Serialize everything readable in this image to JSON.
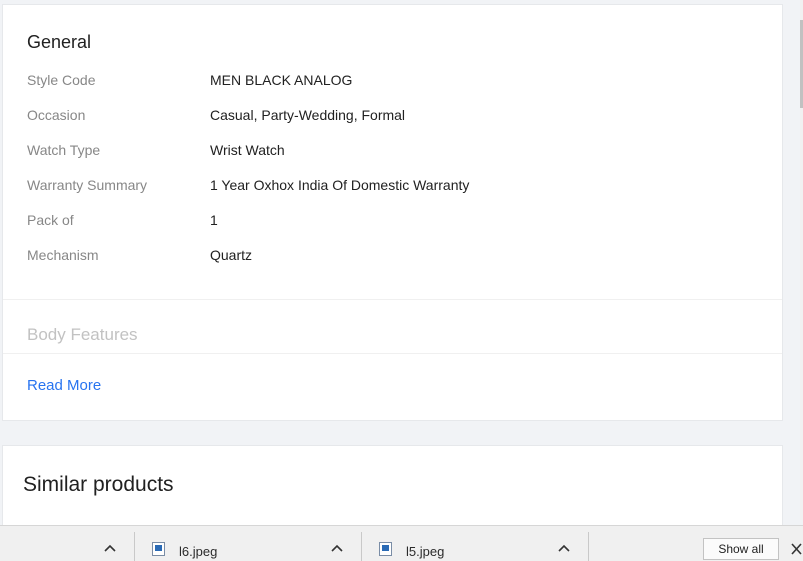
{
  "specs": {
    "section_title": "General",
    "rows": [
      {
        "key": "Style Code",
        "value": "MEN BLACK ANALOG"
      },
      {
        "key": "Occasion",
        "value": "Casual, Party-Wedding, Formal"
      },
      {
        "key": "Watch Type",
        "value": "Wrist Watch"
      },
      {
        "key": "Warranty Summary",
        "value": "1 Year Oxhox India Of Domestic Warranty"
      },
      {
        "key": "Pack of",
        "value": "1"
      },
      {
        "key": "Mechanism",
        "value": "Quartz"
      }
    ],
    "next_section_title": "Body Features",
    "read_more_label": "Read More",
    "read_more_color": "#2874f0"
  },
  "similar": {
    "title": "Similar products"
  },
  "downloads": {
    "files": [
      {
        "name": "l6.jpeg",
        "icon": "image-file-icon"
      },
      {
        "name": "l5.jpeg",
        "icon": "image-file-icon"
      }
    ],
    "show_all_label": "Show all"
  }
}
